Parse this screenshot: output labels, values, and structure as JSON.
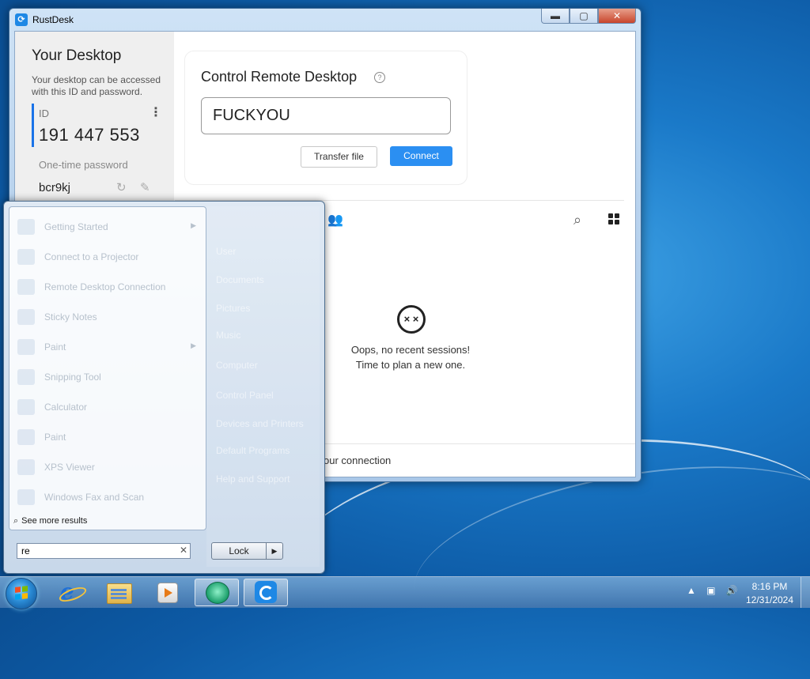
{
  "window": {
    "title": "RustDesk",
    "controls": {
      "minimize": "▬",
      "maximize": "▢",
      "close": "✕"
    }
  },
  "left_panel": {
    "title": "Your Desktop",
    "description": "Your desktop can be accessed with this ID and password.",
    "id_label": "ID",
    "id_value": "191 447 553",
    "password_label": "One-time password",
    "password_value": "bcr9kj"
  },
  "control_card": {
    "title": "Control Remote Desktop",
    "help_glyph": "?",
    "id_input_value": "FUCKYOU",
    "transfer_button": "Transfer file",
    "connect_button": "Connect"
  },
  "sessions": {
    "empty_line1": "Oops, no recent sessions!",
    "empty_line2": "Time to plan a new one."
  },
  "status_bar": {
    "text": "our connection"
  },
  "start_menu": {
    "see_more": "See more results",
    "search_value": "re",
    "clear_glyph": "✕",
    "lock_label": "Lock",
    "lock_arrow": "▶",
    "program_items": [
      {
        "label": "Getting Started",
        "has_arrow": true
      },
      {
        "label": "Connect to a Projector",
        "has_arrow": false
      },
      {
        "label": "Remote Desktop Connection",
        "has_arrow": false
      },
      {
        "label": "Sticky Notes",
        "has_arrow": false
      },
      {
        "label": "Paint",
        "has_arrow": true
      },
      {
        "label": "Snipping Tool",
        "has_arrow": false
      },
      {
        "label": "Calculator",
        "has_arrow": false
      },
      {
        "label": "Paint",
        "has_arrow": false
      },
      {
        "label": "XPS Viewer",
        "has_arrow": false
      },
      {
        "label": "Windows Fax and Scan",
        "has_arrow": false
      }
    ],
    "right_items": [
      "User",
      "Documents",
      "Pictures",
      "Music",
      "Computer",
      "Control Panel",
      "Devices and Printers",
      "Default Programs",
      "Help and Support"
    ]
  },
  "taskbar": {
    "clock_time": "8:16 PM",
    "clock_date": "12/31/2024",
    "tray_icons": [
      "show-hidden-icon",
      "network-icon",
      "volume-icon"
    ]
  }
}
